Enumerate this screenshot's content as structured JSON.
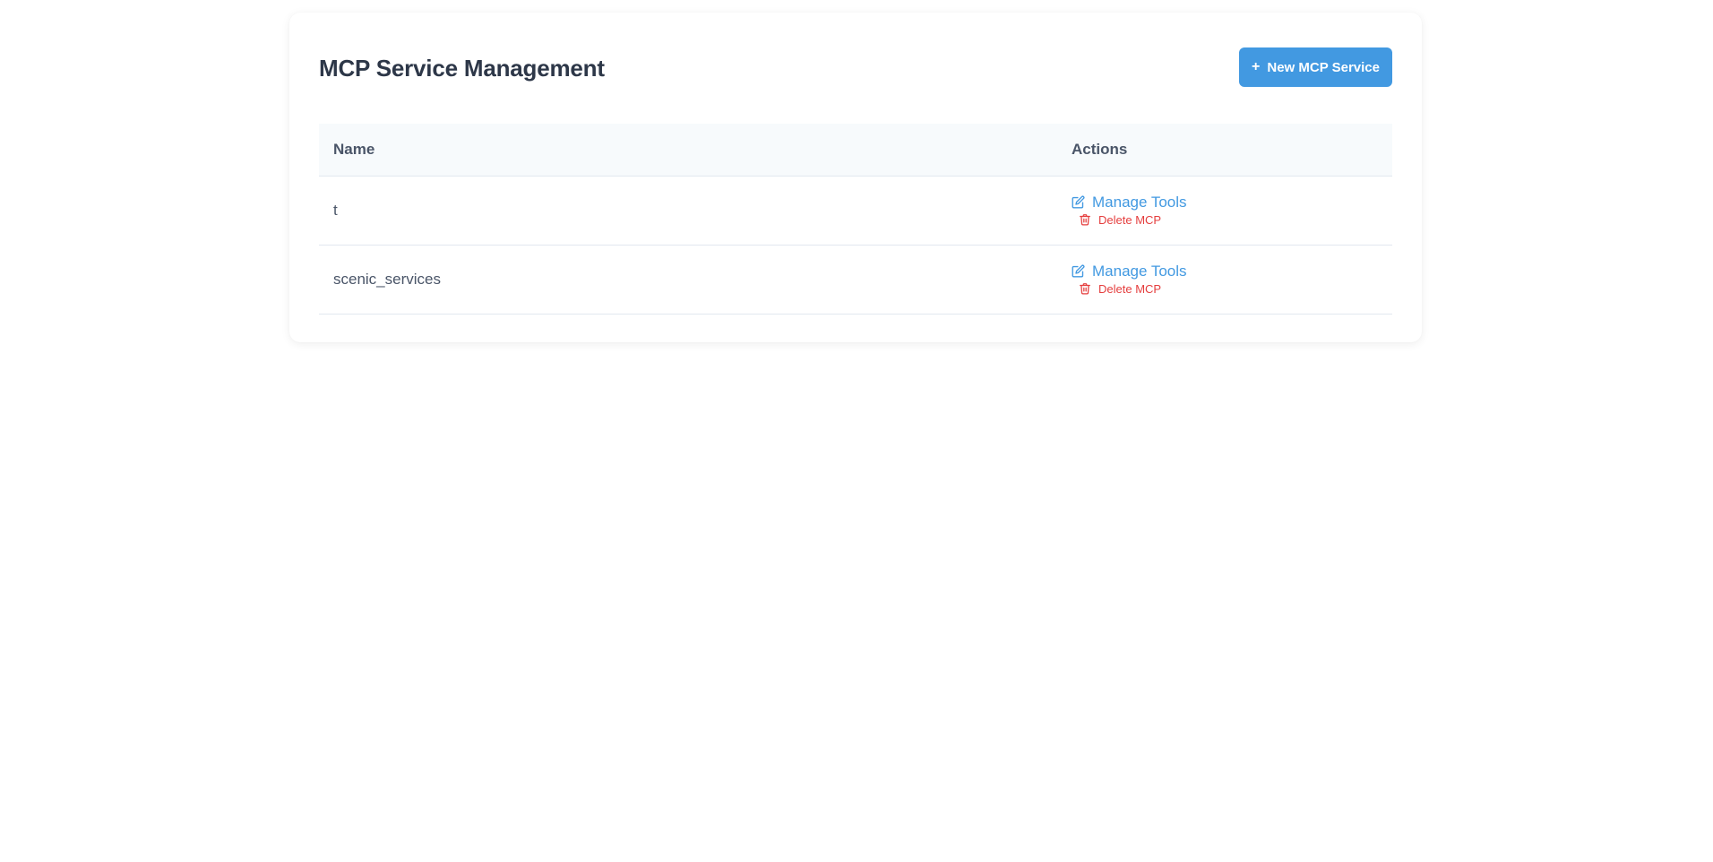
{
  "header": {
    "title": "MCP Service Management",
    "new_button_label": "New MCP Service",
    "new_button_icon": "plus-icon"
  },
  "table": {
    "columns": [
      "Name",
      "Actions"
    ],
    "rows": [
      {
        "name": "t",
        "manage_label": "Manage Tools",
        "delete_label": "Delete MCP"
      },
      {
        "name": "scenic_services",
        "manage_label": "Manage Tools",
        "delete_label": "Delete MCP"
      }
    ]
  },
  "colors": {
    "primary": "#4299e1",
    "danger": "#e53e3e",
    "text": "#2d3748"
  }
}
